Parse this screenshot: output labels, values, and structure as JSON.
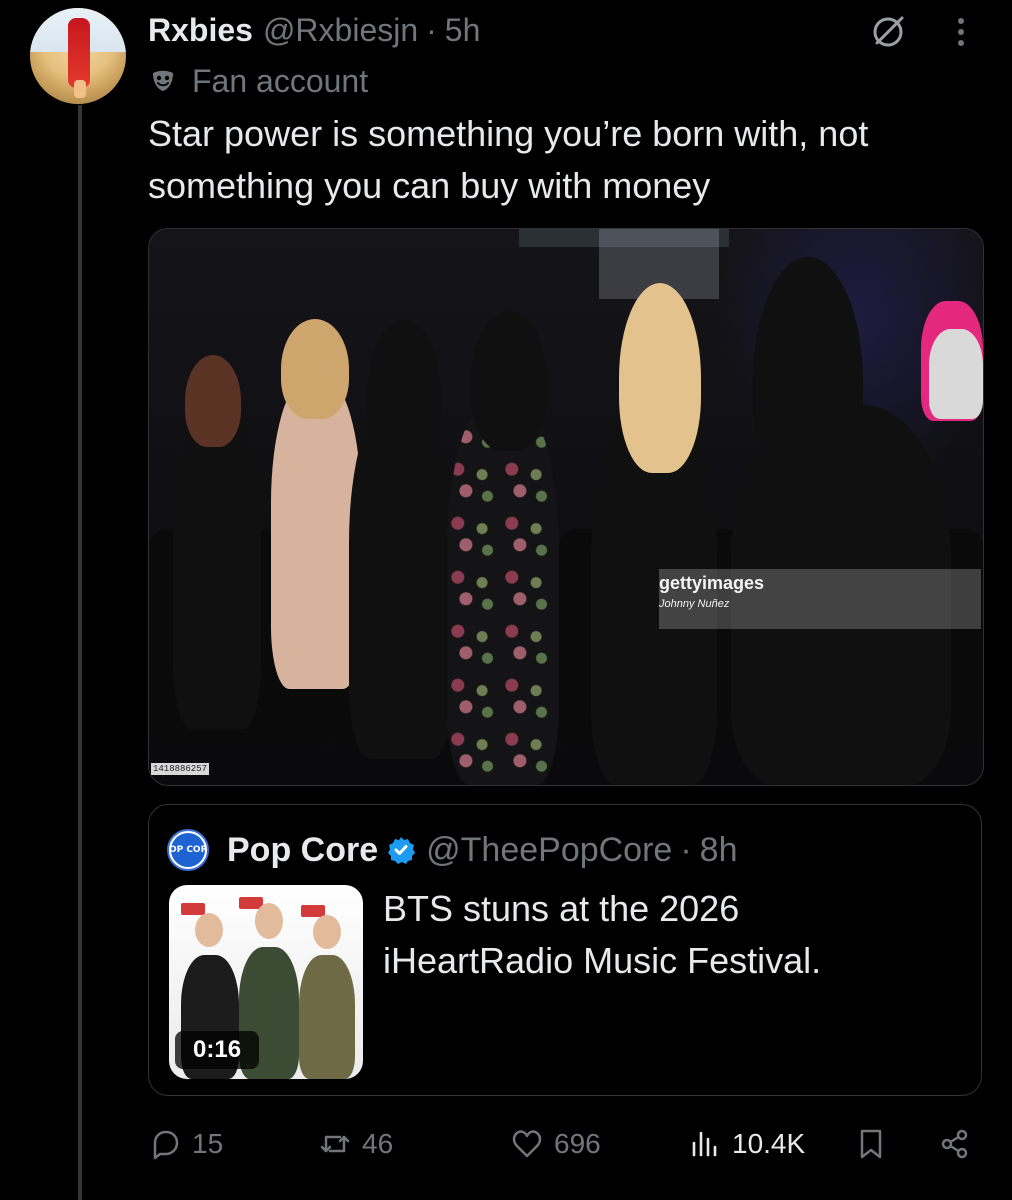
{
  "post": {
    "author_name": "Rxbies",
    "handle": "@Rxbiesjn",
    "separator": "·",
    "time": "5h",
    "label": "Fan account",
    "text_line1": "Star power is something you’re born with, not",
    "text_line2": "something you can buy with money",
    "image_watermark": "gettyimages",
    "image_credit": "Johnny Nuñez",
    "image_id": "1418886257"
  },
  "quoted": {
    "name": "Pop Core",
    "handle": "@TheePopCore",
    "separator": "·",
    "time": "8h",
    "avatar_text": "POP CORE",
    "text_line1": "BTS stuns at the 2026",
    "text_line2": "iHeartRadio Music Festival.",
    "video_duration": "0:16"
  },
  "actions": {
    "replies": "15",
    "reposts": "46",
    "likes": "696",
    "views": "10.4K"
  },
  "colors": {
    "background": "#000000",
    "text_primary": "#e7e9ea",
    "text_secondary": "#71767b",
    "border": "#2f3336",
    "verified": "#1d9bf0"
  },
  "icons": {
    "grok": "grok-icon",
    "more": "more-icon",
    "label": "mask-icon",
    "verified": "verified-icon",
    "reply": "reply-icon",
    "repost": "repost-icon",
    "like": "heart-icon",
    "views": "views-icon",
    "bookmark": "bookmark-icon",
    "share": "share-icon"
  }
}
